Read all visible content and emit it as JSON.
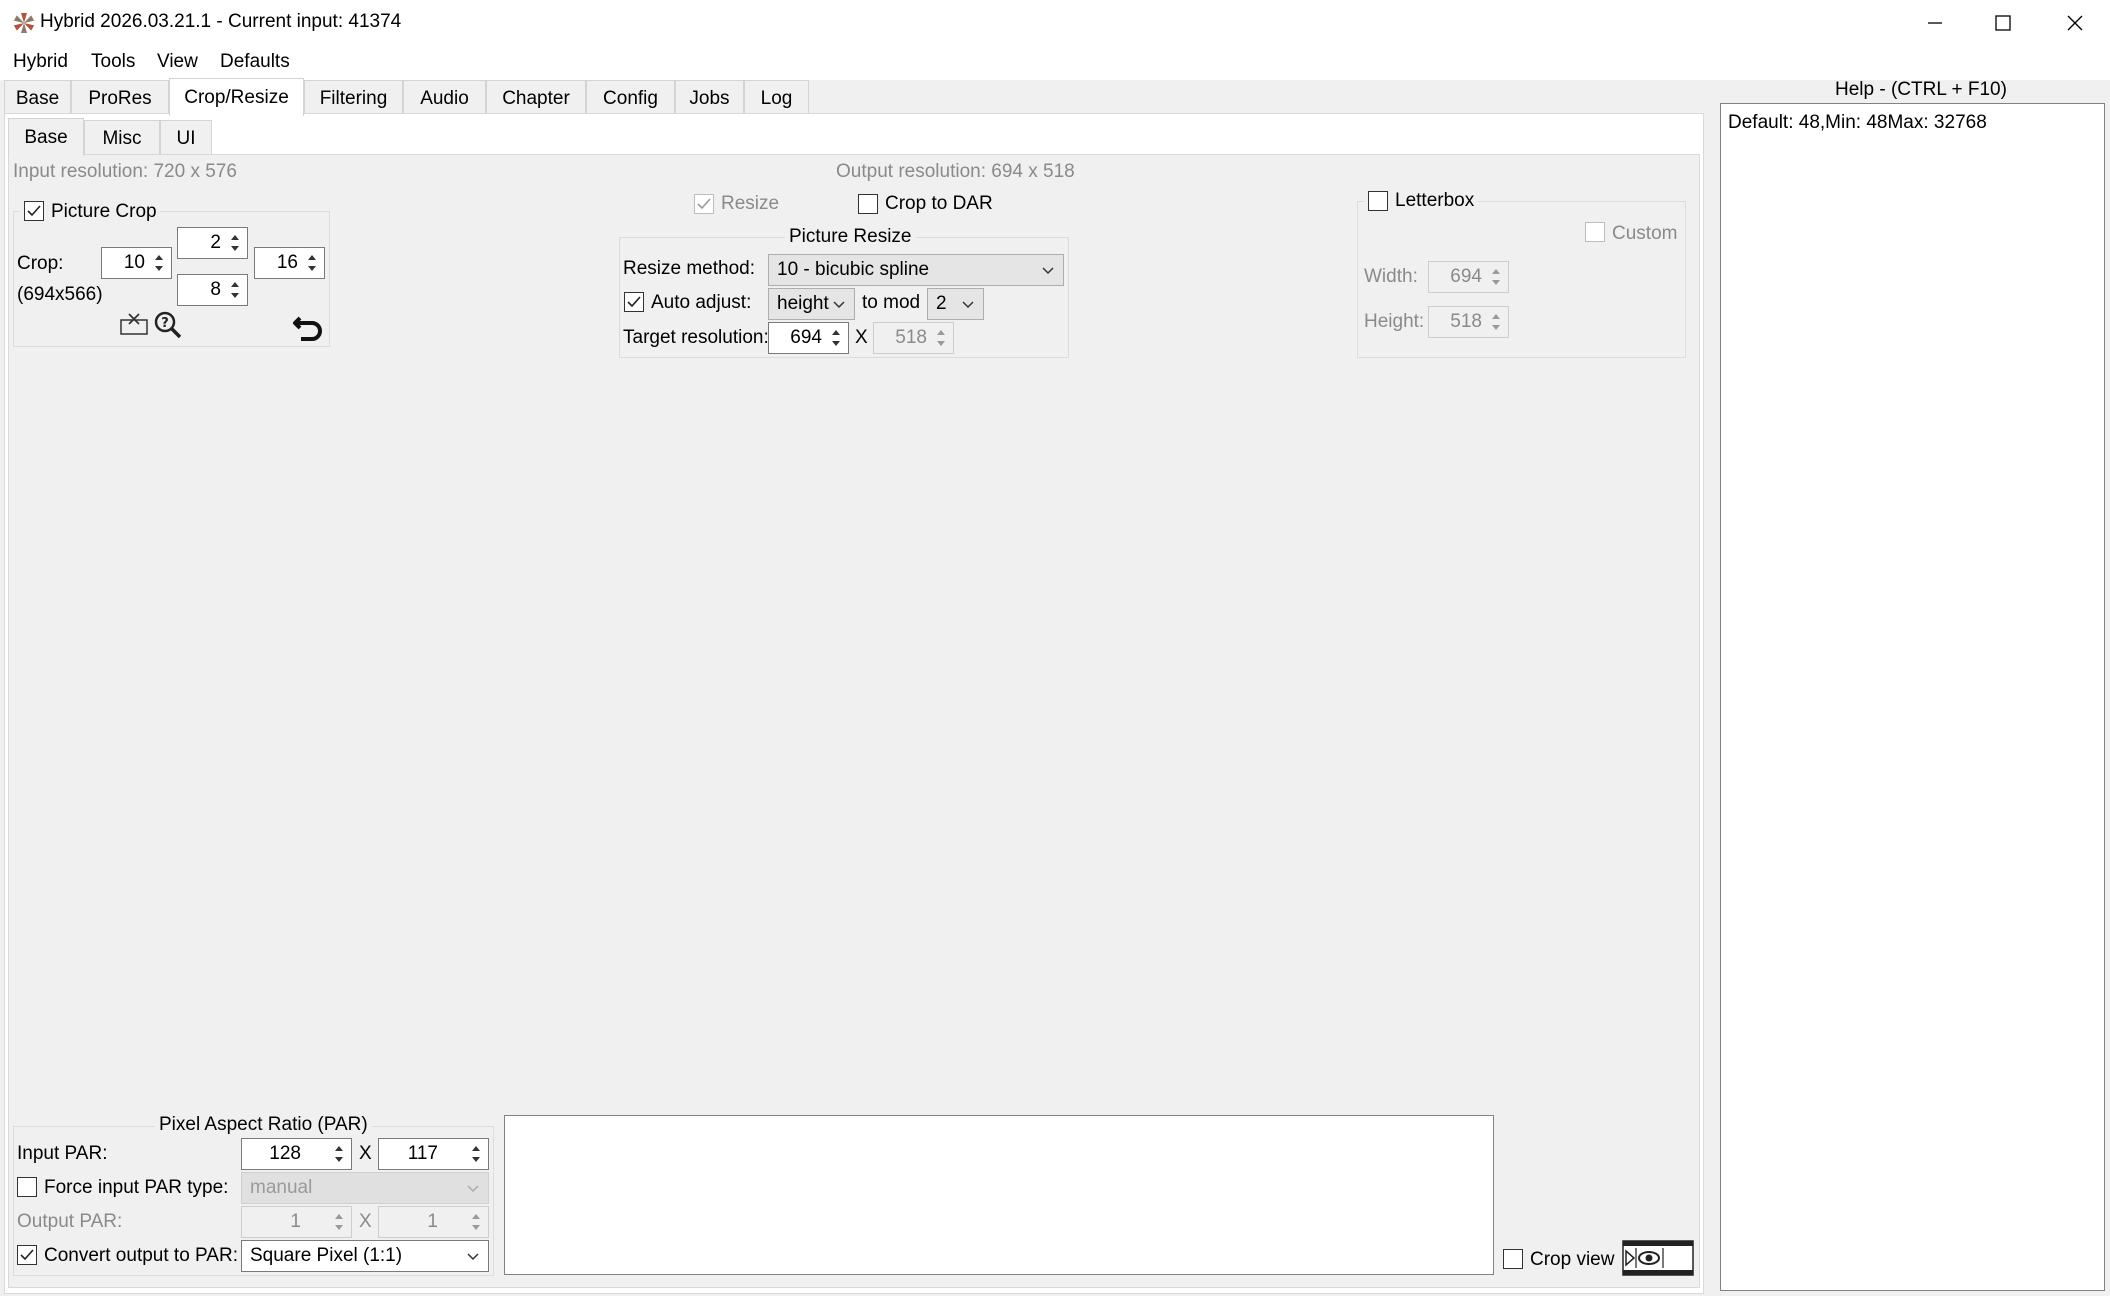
{
  "window": {
    "title": "Hybrid 2026.03.21.1 - Current input: 41374"
  },
  "menu": [
    "Hybrid",
    "Tools",
    "View",
    "Defaults"
  ],
  "main_tabs": [
    "Base",
    "ProRes",
    "Crop/Resize",
    "Filtering",
    "Audio",
    "Chapter",
    "Config",
    "Jobs",
    "Log"
  ],
  "active_main_tab": "Crop/Resize",
  "sub_tabs": [
    "Base",
    "Misc",
    "UI"
  ],
  "active_sub_tab": "Base",
  "input_resolution": "Input resolution: 720 x 576",
  "output_resolution": "Output resolution: 694 x 518",
  "picture_crop": {
    "label": "Picture Crop",
    "checked": true,
    "crop_label": "Crop:",
    "size_text": "(694x566)",
    "left": "10",
    "top": "2",
    "right": "16",
    "bottom": "8"
  },
  "resize": {
    "resize_label": "Resize",
    "resize_checked": true,
    "crop_to_dar_label": "Crop to DAR",
    "crop_to_dar_checked": false,
    "group_title": "Picture Resize",
    "method_label": "Resize method:",
    "method_value": "10 - bicubic spline",
    "auto_adjust_label": "Auto adjust:",
    "auto_adjust_checked": true,
    "auto_adjust_value": "height",
    "to_mod_label": "to mod",
    "mod_value": "2",
    "target_label": "Target resolution:",
    "target_width": "694",
    "x_label": "X",
    "target_height": "518"
  },
  "letterbox": {
    "label": "Letterbox",
    "checked": false,
    "custom_label": "Custom",
    "width_label": "Width:",
    "width_value": "694",
    "height_label": "Height:",
    "height_value": "518"
  },
  "par": {
    "group_title": "Pixel Aspect Ratio (PAR)",
    "input_par_label": "Input PAR:",
    "input_par_num": "128",
    "x_label": "X",
    "input_par_den": "117",
    "force_label": "Force input PAR type:",
    "force_value": "manual",
    "output_par_label": "Output PAR:",
    "output_par_num": "1",
    "output_par_den": "1",
    "convert_label": "Convert output to PAR:",
    "convert_value": "Square Pixel (1:1)"
  },
  "crop_view_label": "Crop view",
  "help": {
    "title": "Help - (CTRL + F10)",
    "text": "Default: 48,Min: 48Max: 32768"
  },
  "colors": {
    "accent_check": "#333333",
    "disabled_text": "#8a8a8a",
    "panel_bg": "#f0f0f0"
  }
}
